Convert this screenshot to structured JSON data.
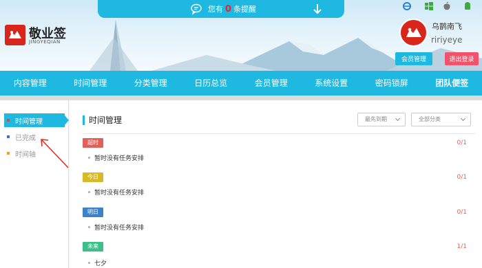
{
  "notice": {
    "prefix": "您有",
    "count": "0",
    "suffix": "条提醒"
  },
  "brand": {
    "name": "敬业签",
    "sub": "JINGYEQIAN"
  },
  "os_icons": [
    "ie-icon",
    "windows-icon",
    "apple-icon",
    "android-icon"
  ],
  "user": {
    "name": "乌鹊南飞",
    "id": "ririyeye",
    "member_label": "会员管理",
    "logout_label": "退出登录"
  },
  "nav": [
    "内容管理",
    "时间管理",
    "分类管理",
    "日历总览",
    "会员管理",
    "系统设置",
    "密码锁屏",
    "团队便签"
  ],
  "sidebar": [
    {
      "label": "时间管理",
      "color": "#e8453c"
    },
    {
      "label": "已完成",
      "color": "#3b6fd4"
    },
    {
      "label": "时间轴",
      "color": "#f0a21b"
    }
  ],
  "main": {
    "title": "时间管理",
    "sort_select": "最先到期",
    "category_select": "全部分类",
    "groups": [
      {
        "tag": "超时",
        "color": "#e0605a",
        "count": "0/1",
        "task": "暂时没有任务安排"
      },
      {
        "tag": "今日",
        "color": "#d6ba2a",
        "count": "0/1",
        "task": "暂时没有任务安排"
      },
      {
        "tag": "明日",
        "color": "#3c82c8",
        "count": "0/1",
        "task": "暂时没有任务安排"
      },
      {
        "tag": "未来",
        "color": "#3dbf8b",
        "count": "1/1",
        "task": "七夕"
      }
    ]
  },
  "colors": {
    "accent": "#1fb8e1",
    "logout": "#f1536a",
    "brand_red": "#d9261c"
  }
}
